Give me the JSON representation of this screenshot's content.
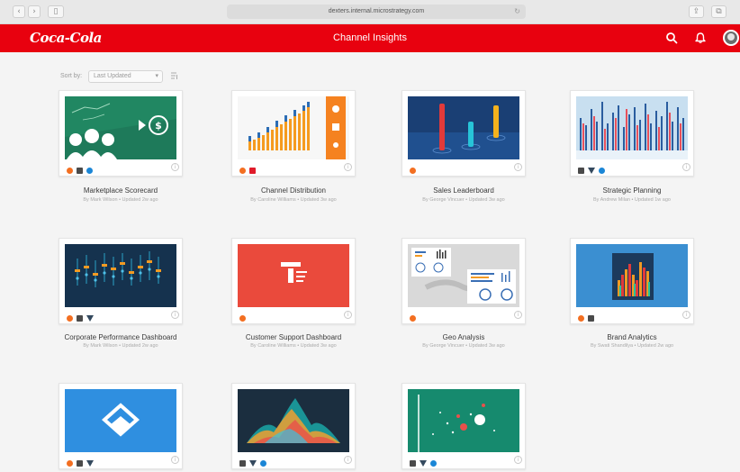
{
  "browser": {
    "url": "dexters.internal.microstrategy.com",
    "back_glyph": "‹",
    "forward_glyph": "›",
    "sidebar_glyph": "▯",
    "reload_glyph": "↻",
    "share_glyph": "⇪",
    "tabs_glyph": "⧉"
  },
  "header": {
    "brand": "Coca-Cola",
    "title": "Channel Insights",
    "background": "#e8010f",
    "icons": [
      "search-icon",
      "bell-icon",
      "avatar"
    ]
  },
  "sort": {
    "label": "Sort by:",
    "selected": "Last Updated",
    "arrow": "▾"
  },
  "info_glyph": "i",
  "cards": [
    {
      "title": "Marketplace Scorecard",
      "subtitle": "By Mark Wilson • Updated 2w ago",
      "badges": [
        "orange",
        "gray",
        "blue"
      ]
    },
    {
      "title": "Channel Distribution",
      "subtitle": "By Caroline Williams • Updated 3w ago",
      "badges": [
        "orange",
        "red"
      ]
    },
    {
      "title": "Sales Leaderboard",
      "subtitle": "By George Vincuer • Updated 3w ago",
      "badges": [
        "orange"
      ]
    },
    {
      "title": "Strategic Planning",
      "subtitle": "By Andrew Milan • Updated 1w ago",
      "badges": [
        "gray",
        "filter",
        "blue"
      ]
    },
    {
      "title": "Corporate Performance Dashboard",
      "subtitle": "By Mark Wilson • Updated 2w ago",
      "badges": [
        "orange",
        "gray",
        "filter"
      ]
    },
    {
      "title": "Customer Support Dashboard",
      "subtitle": "By Caroline Williams • Updated 3w ago",
      "badges": [
        "orange"
      ]
    },
    {
      "title": "Geo Analysis",
      "subtitle": "By George Vincuer • Updated 3w ago",
      "badges": [
        "orange"
      ]
    },
    {
      "title": "Brand Analytics",
      "subtitle": "By Swati Shandilya • Updated 2w ago",
      "badges": [
        "orange",
        "gray"
      ]
    },
    {
      "title": "",
      "subtitle": "",
      "badges": [
        "orange",
        "gray",
        "filter"
      ]
    },
    {
      "title": "",
      "subtitle": "",
      "badges": [
        "gray",
        "filter",
        "blue"
      ]
    },
    {
      "title": "",
      "subtitle": "",
      "badges": [
        "gray",
        "filter",
        "blue"
      ]
    }
  ]
}
